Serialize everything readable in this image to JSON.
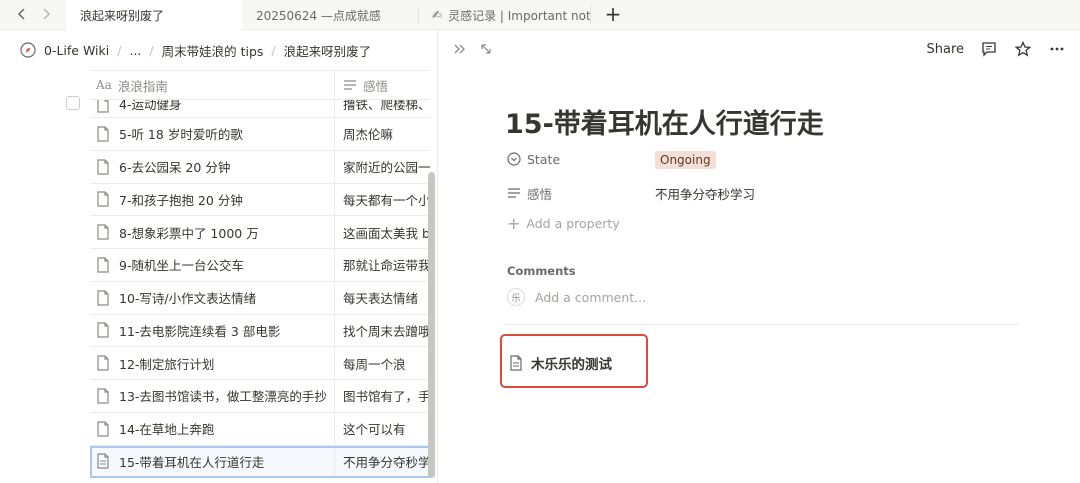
{
  "tabs": [
    {
      "label": "浪起来呀别废了",
      "active": true
    },
    {
      "label": "20250624 —点成就感",
      "active": false
    },
    {
      "label": "灵感记录 | Important not",
      "active": false,
      "icon": "pencil-icon"
    }
  ],
  "breadcrumb": [
    "0-Life Wiki",
    "...",
    "周末带娃浪的 tips",
    "浪起来呀别废了"
  ],
  "table": {
    "col_title": "浪浪指南",
    "col_feel": "感悟",
    "rows": [
      {
        "title": "4-运动健身",
        "feel": "撸铁、爬楼梯、"
      },
      {
        "title": "5-听 18 岁时爱听的歌",
        "feel": "周杰伦嘛"
      },
      {
        "title": "6-去公园呆 20 分钟",
        "feel": "家附近的公园一"
      },
      {
        "title": "7-和孩子抱抱 20 分钟",
        "feel": "每天都有一个小"
      },
      {
        "title": "8-想象彩票中了 1000 万",
        "feel": "这画面太美我 bu"
      },
      {
        "title": "9-随机坐上一台公交车",
        "feel": "那就让命运带我"
      },
      {
        "title": "10-写诗/小作文表达情绪",
        "feel": "每天表达情绪"
      },
      {
        "title": "11-去电影院连续看 3 部电影",
        "feel": "找个周末去蹭哦"
      },
      {
        "title": "12-制定旅行计划",
        "feel": "每周一个浪"
      },
      {
        "title": "13-去图书馆读书，做工整漂亮的手抄",
        "feel": "图书馆有了，手"
      },
      {
        "title": "14-在草地上奔跑",
        "feel": "这个可以有"
      },
      {
        "title": "15-带着耳机在人行道行走",
        "feel": "不用争分夺秒学"
      }
    ]
  },
  "page": {
    "title": "15-带着耳机在人行道行走",
    "state_label": "State",
    "state_value": "Ongoing",
    "feel_label": "感悟",
    "feel_value": "不用争分夺秒学习",
    "add_property": "Add a property",
    "comments_label": "Comments",
    "avatar_char": "乐",
    "comment_placeholder": "Add a comment...",
    "subpage_title": "木乐乐的测试"
  },
  "toolbar": {
    "share": "Share"
  },
  "colors": {
    "badge_bg": "#f4dfd6",
    "highlight": "#e04a3a",
    "selected_outline": "#a8c8f0"
  }
}
